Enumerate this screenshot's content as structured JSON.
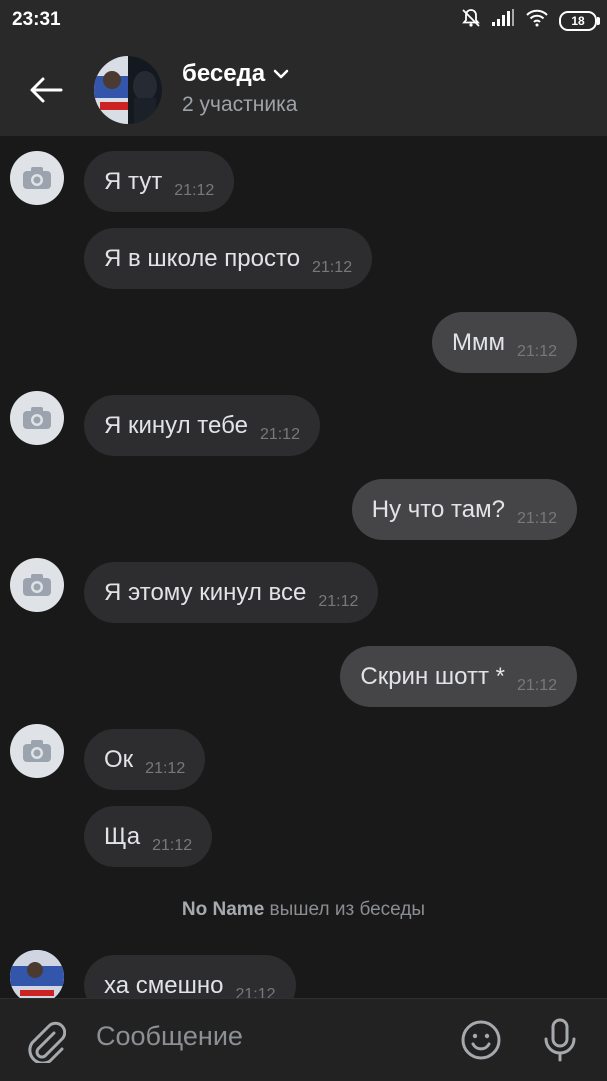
{
  "status_bar": {
    "time": "23:31",
    "battery": "18"
  },
  "header": {
    "title": "беседа",
    "subtitle": "2 участника"
  },
  "messages": [
    {
      "text": "Я тут",
      "time": "21:12"
    },
    {
      "text": "Я в школе просто",
      "time": "21:12"
    },
    {
      "text": "Ммм",
      "time": "21:12"
    },
    {
      "text": "Я кинул тебе",
      "time": "21:12"
    },
    {
      "text": "Ну что там?",
      "time": "21:12"
    },
    {
      "text": "Я этому кинул все",
      "time": "21:12"
    },
    {
      "text": "Скрин шотт *",
      "time": "21:12"
    },
    {
      "text": "Ок",
      "time": "21:12"
    },
    {
      "text": "Ща",
      "time": "21:12"
    },
    {
      "text": "ха смешно",
      "time": "21:12"
    }
  ],
  "service": {
    "name": "No Name",
    "action": "вышел из беседы"
  },
  "composer": {
    "placeholder": "Сообщение"
  },
  "colors": {
    "background": "#191919",
    "incoming_bubble": "#2d2d2f",
    "outgoing_bubble": "#454547",
    "bar": "#292929"
  }
}
